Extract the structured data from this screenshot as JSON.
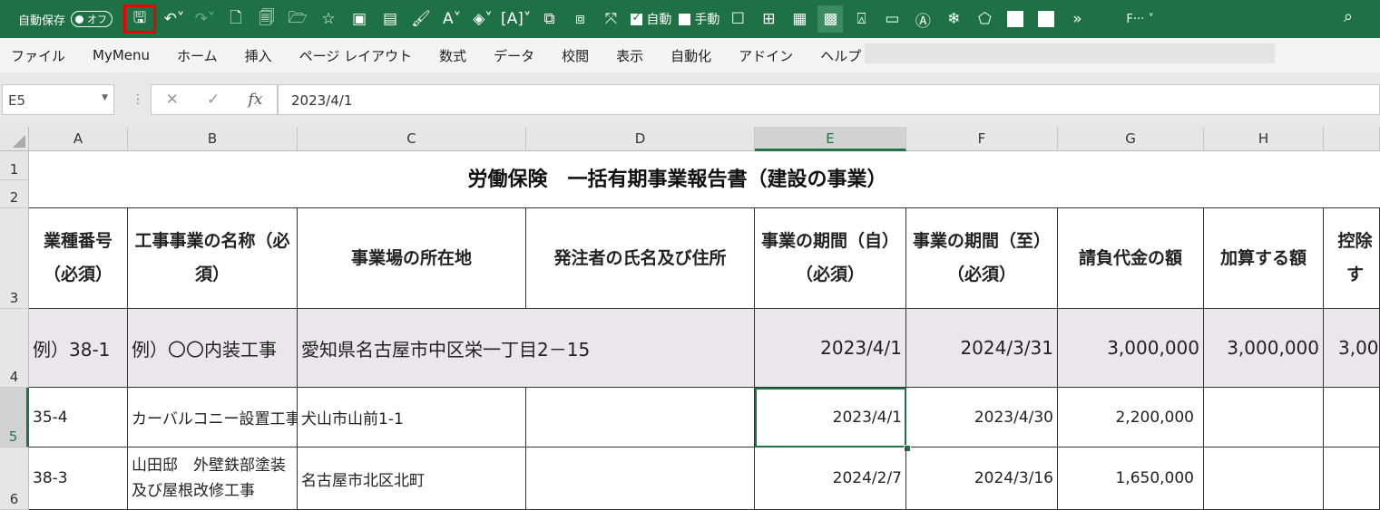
{
  "qat": {
    "autosave_label": "自動保存",
    "autosave_state": "オフ",
    "check1_label": "自動",
    "check2_label": "手動",
    "file_label": "F···",
    "more": "»",
    "icons": [
      "save-icon",
      "undo-icon",
      "redo-icon",
      "new-file-icon",
      "print-preview-icon",
      "open-folder-icon",
      "favorite-icon",
      "image-icon",
      "form-icon",
      "paint-brush-icon",
      "font-color-icon",
      "fill-color-icon",
      "textbox-icon",
      "shape-icon",
      "group-icon",
      "clear-format-icon"
    ]
  },
  "menu": {
    "items": [
      "ファイル",
      "MyMenu",
      "ホーム",
      "挿入",
      "ページ レイアウト",
      "数式",
      "データ",
      "校閲",
      "表示",
      "自動化",
      "アドイン",
      "ヘルプ"
    ]
  },
  "formula_bar": {
    "name_box": "E5",
    "cancel": "✕",
    "enter": "✓",
    "fx": "fx",
    "value": "2023/4/1"
  },
  "columns": [
    "A",
    "B",
    "C",
    "D",
    "E",
    "F",
    "G",
    "H"
  ],
  "rows": [
    "1",
    "2",
    "3",
    "4",
    "5",
    "6"
  ],
  "sheet": {
    "title": "労働保険　一括有期事業報告書（建設の事業）",
    "headers": {
      "a": "業種番号（必須）",
      "b": "工事事業の名称（必須）",
      "c": "事業場の所在地",
      "d": "発注者の氏名及び住所",
      "e": "事業の期間（自）（必須）",
      "f": "事業の期間（至）（必須）",
      "g": "請負代金の額",
      "h": "加算する額",
      "i": "控除す"
    },
    "example": {
      "a": "例）38-1",
      "b": "例）〇〇内装工事",
      "c": "愛知県名古屋市中区栄一丁目2－15",
      "e": "2023/4/1",
      "f": "2024/3/31",
      "g": "3,000,000",
      "h": "3,000,000",
      "i": "3,00"
    },
    "row5": {
      "a": "35-4",
      "b": "カーバルコニー設置工事",
      "c": "犬山市山前1-1",
      "e": "2023/4/1",
      "f": "2023/4/30",
      "g": "2,200,000"
    },
    "row6": {
      "a": "38-3",
      "b": "山田邸　外壁鉄部塗装及び屋根改修工事",
      "c": "名古屋市北区北町",
      "e": "2024/2/7",
      "f": "2024/3/16",
      "g": "1,650,000"
    }
  },
  "colors": {
    "excel_green": "#1e7145",
    "highlight_red": "#e00000",
    "example_row_bg": "#e9e7e9"
  }
}
